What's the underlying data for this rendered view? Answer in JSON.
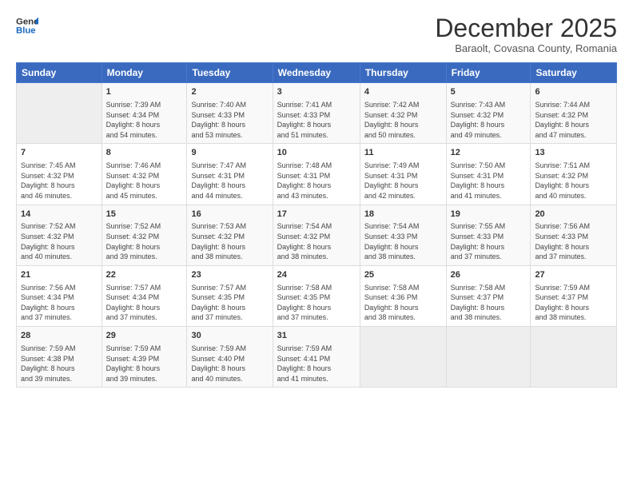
{
  "header": {
    "logo_line1": "General",
    "logo_line2": "Blue",
    "title": "December 2025",
    "subtitle": "Baraolt, Covasna County, Romania"
  },
  "days_of_week": [
    "Sunday",
    "Monday",
    "Tuesday",
    "Wednesday",
    "Thursday",
    "Friday",
    "Saturday"
  ],
  "weeks": [
    [
      {
        "day": "",
        "detail": ""
      },
      {
        "day": "1",
        "detail": "Sunrise: 7:39 AM\nSunset: 4:34 PM\nDaylight: 8 hours\nand 54 minutes."
      },
      {
        "day": "2",
        "detail": "Sunrise: 7:40 AM\nSunset: 4:33 PM\nDaylight: 8 hours\nand 53 minutes."
      },
      {
        "day": "3",
        "detail": "Sunrise: 7:41 AM\nSunset: 4:33 PM\nDaylight: 8 hours\nand 51 minutes."
      },
      {
        "day": "4",
        "detail": "Sunrise: 7:42 AM\nSunset: 4:32 PM\nDaylight: 8 hours\nand 50 minutes."
      },
      {
        "day": "5",
        "detail": "Sunrise: 7:43 AM\nSunset: 4:32 PM\nDaylight: 8 hours\nand 49 minutes."
      },
      {
        "day": "6",
        "detail": "Sunrise: 7:44 AM\nSunset: 4:32 PM\nDaylight: 8 hours\nand 47 minutes."
      }
    ],
    [
      {
        "day": "7",
        "detail": "Sunrise: 7:45 AM\nSunset: 4:32 PM\nDaylight: 8 hours\nand 46 minutes."
      },
      {
        "day": "8",
        "detail": "Sunrise: 7:46 AM\nSunset: 4:32 PM\nDaylight: 8 hours\nand 45 minutes."
      },
      {
        "day": "9",
        "detail": "Sunrise: 7:47 AM\nSunset: 4:31 PM\nDaylight: 8 hours\nand 44 minutes."
      },
      {
        "day": "10",
        "detail": "Sunrise: 7:48 AM\nSunset: 4:31 PM\nDaylight: 8 hours\nand 43 minutes."
      },
      {
        "day": "11",
        "detail": "Sunrise: 7:49 AM\nSunset: 4:31 PM\nDaylight: 8 hours\nand 42 minutes."
      },
      {
        "day": "12",
        "detail": "Sunrise: 7:50 AM\nSunset: 4:31 PM\nDaylight: 8 hours\nand 41 minutes."
      },
      {
        "day": "13",
        "detail": "Sunrise: 7:51 AM\nSunset: 4:32 PM\nDaylight: 8 hours\nand 40 minutes."
      }
    ],
    [
      {
        "day": "14",
        "detail": "Sunrise: 7:52 AM\nSunset: 4:32 PM\nDaylight: 8 hours\nand 40 minutes."
      },
      {
        "day": "15",
        "detail": "Sunrise: 7:52 AM\nSunset: 4:32 PM\nDaylight: 8 hours\nand 39 minutes."
      },
      {
        "day": "16",
        "detail": "Sunrise: 7:53 AM\nSunset: 4:32 PM\nDaylight: 8 hours\nand 38 minutes."
      },
      {
        "day": "17",
        "detail": "Sunrise: 7:54 AM\nSunset: 4:32 PM\nDaylight: 8 hours\nand 38 minutes."
      },
      {
        "day": "18",
        "detail": "Sunrise: 7:54 AM\nSunset: 4:33 PM\nDaylight: 8 hours\nand 38 minutes."
      },
      {
        "day": "19",
        "detail": "Sunrise: 7:55 AM\nSunset: 4:33 PM\nDaylight: 8 hours\nand 37 minutes."
      },
      {
        "day": "20",
        "detail": "Sunrise: 7:56 AM\nSunset: 4:33 PM\nDaylight: 8 hours\nand 37 minutes."
      }
    ],
    [
      {
        "day": "21",
        "detail": "Sunrise: 7:56 AM\nSunset: 4:34 PM\nDaylight: 8 hours\nand 37 minutes."
      },
      {
        "day": "22",
        "detail": "Sunrise: 7:57 AM\nSunset: 4:34 PM\nDaylight: 8 hours\nand 37 minutes."
      },
      {
        "day": "23",
        "detail": "Sunrise: 7:57 AM\nSunset: 4:35 PM\nDaylight: 8 hours\nand 37 minutes."
      },
      {
        "day": "24",
        "detail": "Sunrise: 7:58 AM\nSunset: 4:35 PM\nDaylight: 8 hours\nand 37 minutes."
      },
      {
        "day": "25",
        "detail": "Sunrise: 7:58 AM\nSunset: 4:36 PM\nDaylight: 8 hours\nand 38 minutes."
      },
      {
        "day": "26",
        "detail": "Sunrise: 7:58 AM\nSunset: 4:37 PM\nDaylight: 8 hours\nand 38 minutes."
      },
      {
        "day": "27",
        "detail": "Sunrise: 7:59 AM\nSunset: 4:37 PM\nDaylight: 8 hours\nand 38 minutes."
      }
    ],
    [
      {
        "day": "28",
        "detail": "Sunrise: 7:59 AM\nSunset: 4:38 PM\nDaylight: 8 hours\nand 39 minutes."
      },
      {
        "day": "29",
        "detail": "Sunrise: 7:59 AM\nSunset: 4:39 PM\nDaylight: 8 hours\nand 39 minutes."
      },
      {
        "day": "30",
        "detail": "Sunrise: 7:59 AM\nSunset: 4:40 PM\nDaylight: 8 hours\nand 40 minutes."
      },
      {
        "day": "31",
        "detail": "Sunrise: 7:59 AM\nSunset: 4:41 PM\nDaylight: 8 hours\nand 41 minutes."
      },
      {
        "day": "",
        "detail": ""
      },
      {
        "day": "",
        "detail": ""
      },
      {
        "day": "",
        "detail": ""
      }
    ]
  ]
}
